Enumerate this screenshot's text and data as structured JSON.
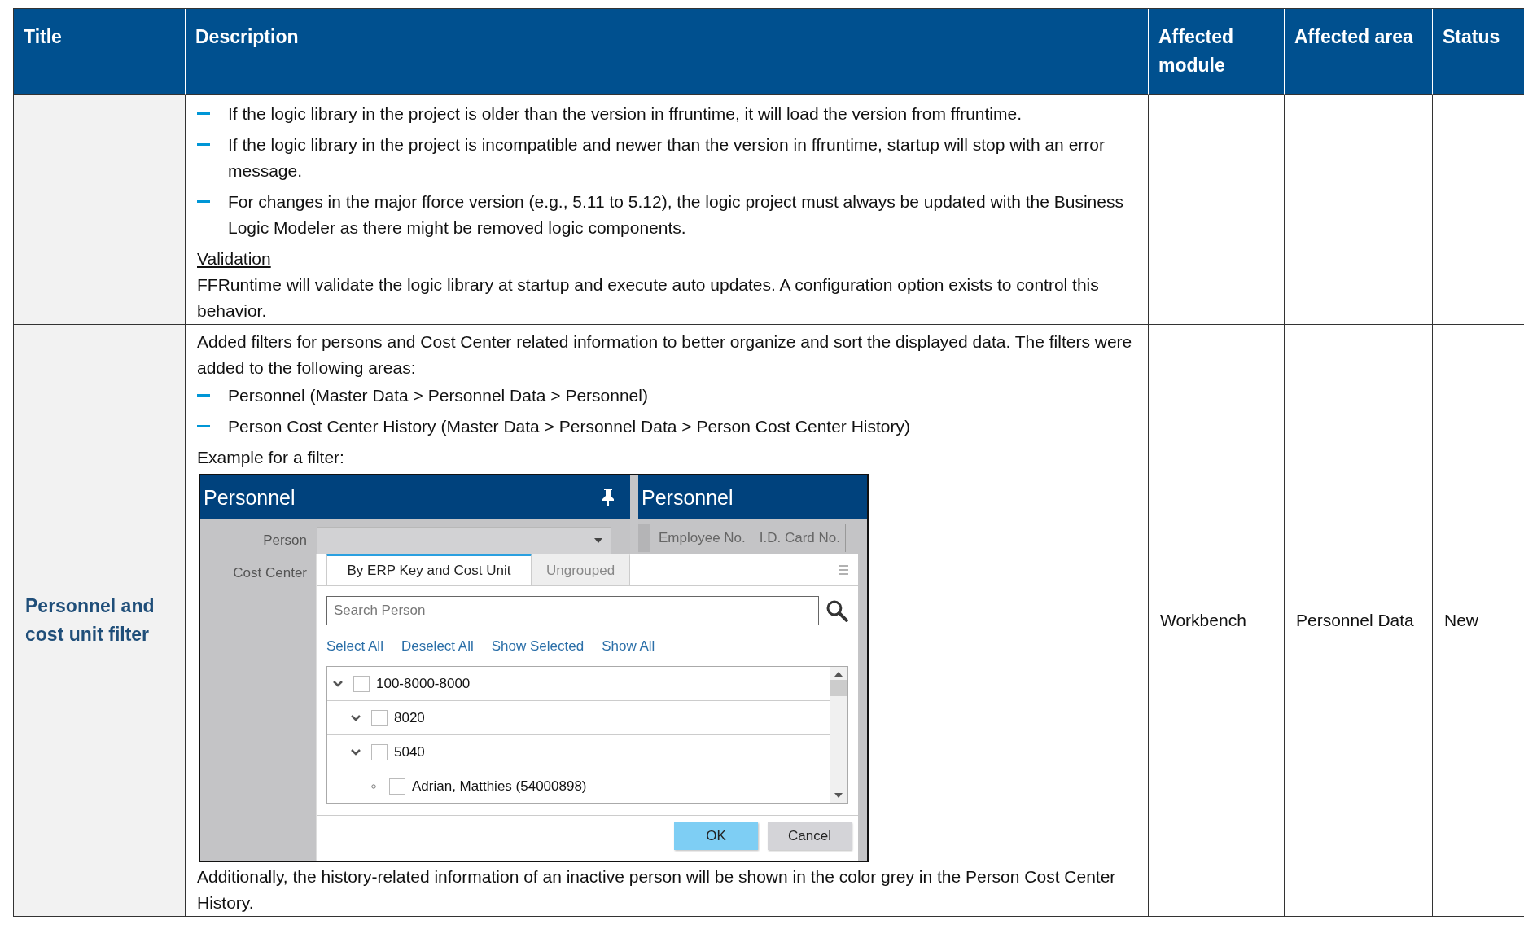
{
  "table": {
    "columns": [
      "Title",
      "Description",
      "Affected module",
      "Affected area",
      "Status"
    ],
    "rows": [
      {
        "description": [
          {
            "kind": "bullet",
            "text": "If the logic library in the project is older than the version in ffruntime, it will load the version from ffruntime."
          },
          {
            "kind": "bullet",
            "text": "If the logic library in the project is incompatible and newer than the version in ffruntime, startup will stop with an error message."
          },
          {
            "kind": "bullet",
            "text": "For changes in the major fforce version (e.g., 5.11 to 5.12), the logic project must always be updated with the Business Logic Modeler as there might be removed logic components."
          },
          {
            "kind": "heading",
            "text": "Validation"
          },
          {
            "kind": "paragraph",
            "text": "FFRuntime will validate the logic library at startup and execute auto updates. A configuration option exists to control this behavior."
          }
        ]
      },
      {
        "title": "Personnel and cost unit filter",
        "module": "Workbench",
        "area": "Personnel Data",
        "status": "New",
        "description": [
          {
            "kind": "paragraph",
            "text": "Added filters for persons and Cost Center related information to better organize and sort the displayed data. The filters were added to the following areas:"
          },
          {
            "kind": "bullet",
            "text": "Personnel (Master Data > Personnel Data > Personnel)"
          },
          {
            "kind": "bullet",
            "text": "Person Cost Center History (Master Data > Personnel Data > Person Cost Center History)"
          },
          {
            "kind": "paragraph",
            "text": "Example for a filter:"
          },
          {
            "kind": "figure",
            "filter_panel": {
              "title": "Personnel",
              "fields": [
                {
                  "label": "Person"
                },
                {
                  "label": "Cost Center"
                }
              ],
              "popup": {
                "tabs": [
                  {
                    "label": "By ERP Key and Cost Unit",
                    "selected": true
                  },
                  {
                    "label": "Ungrouped",
                    "selected": false
                  }
                ],
                "search": {
                  "placeholder": "Search Person"
                },
                "links": [
                  "Select All",
                  "Deselect All",
                  "Show Selected",
                  "Show All"
                ],
                "tree": [
                  {
                    "label": "100-8000-8000",
                    "kind": "group",
                    "checked": false,
                    "expanded": true,
                    "children": [
                      {
                        "label": "8020",
                        "kind": "group",
                        "checked": false,
                        "expanded": true
                      },
                      {
                        "label": "5040",
                        "kind": "group",
                        "checked": false,
                        "expanded": true,
                        "children": [
                          {
                            "label": "Adrian, Matthies (54000898)",
                            "kind": "leaf",
                            "checked": false
                          }
                        ]
                      }
                    ]
                  }
                ],
                "buttons": [
                  {
                    "label": "OK",
                    "kind": "primary"
                  },
                  {
                    "label": "Cancel",
                    "kind": "secondary"
                  }
                ]
              }
            },
            "list_panel": {
              "title": "Personnel",
              "columns": [
                "Employee No.",
                "I.D. Card No."
              ]
            }
          },
          {
            "kind": "paragraph",
            "text": "Additionally, the history-related information of an inactive person will be shown in the color grey in the Person Cost Center History."
          }
        ]
      }
    ]
  }
}
